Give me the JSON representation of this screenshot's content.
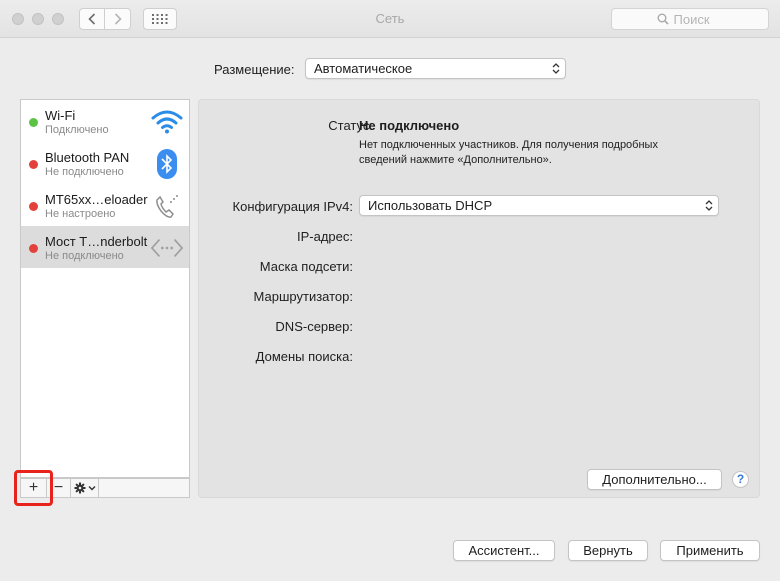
{
  "window": {
    "title": "Сеть",
    "search_placeholder": "Поиск"
  },
  "location": {
    "label": "Размещение:",
    "value": "Автоматическое"
  },
  "services": [
    {
      "name": "Wi-Fi",
      "status": "Подключено",
      "status_color": "#5cc444",
      "icon": "wifi-icon"
    },
    {
      "name": "Bluetooth PAN",
      "status": "Не подключено",
      "status_color": "#e5413b",
      "icon": "bluetooth-icon"
    },
    {
      "name": "MT65xx…eloader",
      "status": "Не настроено",
      "status_color": "#e5413b",
      "icon": "phone-icon"
    },
    {
      "name": "Мост T…nderbolt",
      "status": "Не подключено",
      "status_color": "#e5413b",
      "icon": "thunderbolt-bridge-icon",
      "selected": true
    }
  ],
  "sidebar_toolbar": {
    "add": "+",
    "remove": "−"
  },
  "detail": {
    "status_label": "Статус:",
    "status_value": "Не подключено",
    "status_description": "Нет подключенных участников. Для получения подробных сведений нажмите «Дополнительно».",
    "ipv4_label": "Конфигурация IPv4:",
    "ipv4_value": "Использовать DHCP",
    "ip_label": "IP-адрес:",
    "mask_label": "Маска подсети:",
    "router_label": "Маршрутизатор:",
    "dns_label": "DNS-сервер:",
    "domains_label": "Домены поиска:",
    "advanced_button": "Дополнительно...",
    "help": "?"
  },
  "footer": {
    "assistant_button": "Ассистент...",
    "revert_button": "Вернуть",
    "apply_button": "Применить"
  },
  "colors": {
    "highlight": "#e8231c",
    "wifi_blue": "#2b8de8",
    "bluetooth_blue": "#3a8ef0"
  }
}
